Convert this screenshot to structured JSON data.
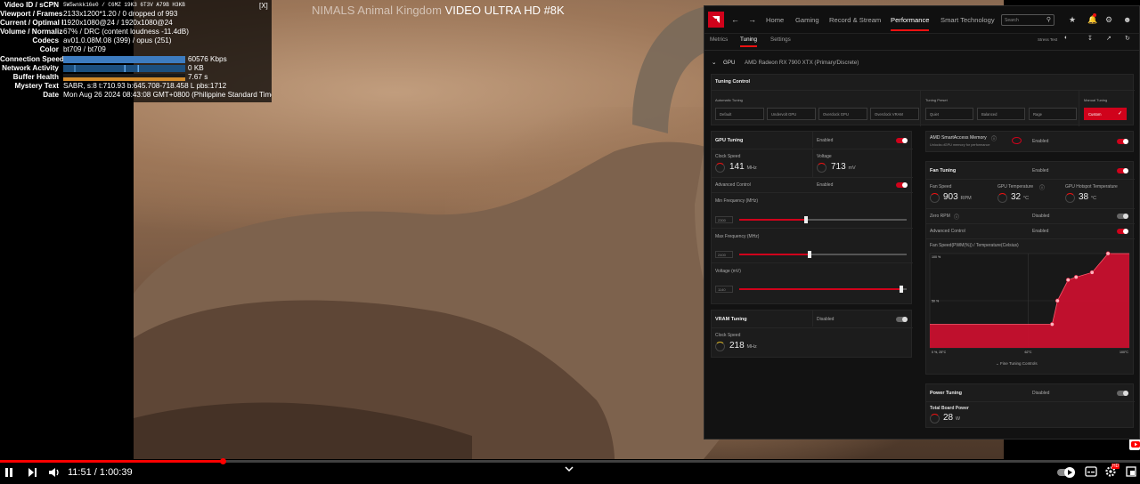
{
  "video": {
    "title_dim": "NIMALS Animal Kingdom",
    "title_bright": "VIDEO ULTRA HD #8K"
  },
  "stats": {
    "close_label": "[X]",
    "rows": [
      {
        "label": "Video ID / sCPN",
        "value": "5W5wnkk16e0 / C6MZ 19K3 6T3V A79B H3KB"
      },
      {
        "label": "Viewport / Frames",
        "value": "2133x1200*1.20 / 0 dropped of 993"
      },
      {
        "label": "Current / Optimal Res",
        "value": "1920x1080@24 / 1920x1080@24"
      },
      {
        "label": "Volume / Normalized",
        "value": "67% / DRC (content loudness -11.4dB)"
      },
      {
        "label": "Codecs",
        "value": "av01.0.08M.08 (399) / opus (251)"
      },
      {
        "label": "Color",
        "value": "bt709 / bt709"
      },
      {
        "label": "Connection Speed",
        "value": "60576 Kbps"
      },
      {
        "label": "Network Activity",
        "value": "0 KB"
      },
      {
        "label": "Buffer Health",
        "value": "7.67 s"
      },
      {
        "label": "Mystery Text",
        "value": "SABR, s:8 t:710.93 b:645.708-718.458 L pbs:1712"
      },
      {
        "label": "Date",
        "value": "Mon Aug 26 2024 08:43:08 GMT+0800 (Philippine Standard Time)"
      }
    ]
  },
  "player": {
    "time_current": "11:51",
    "time_separator": " / ",
    "time_total": "1:00:39",
    "progress_fraction": 0.195,
    "pause_icon": "pause-icon",
    "next_icon": "next-icon",
    "volume_icon": "volume-icon",
    "autoplay_icon": "autoplay-toggle-icon",
    "settings_icon": "gear-icon",
    "hd_badge": "HD",
    "expand_icon": "chevron-down-icon"
  },
  "amd": {
    "logo": "AMD",
    "nav": [
      "Home",
      "Gaming",
      "Record & Stream",
      "Performance",
      "Smart Technology"
    ],
    "nav_active": "Performance",
    "search_placeholder": "Search",
    "subtabs": [
      "Metrics",
      "Tuning",
      "Settings"
    ],
    "subtab_active": "Tuning",
    "stress_test": "Stress Test",
    "gpu_label": "GPU",
    "gpu_name": "AMD Radeon RX 7900 XTX (Primary/Discrete)",
    "tuning_control": {
      "title": "Tuning Control",
      "automatic_label": "Automatic Tuning",
      "automatic_options": [
        "Default",
        "Undervolt GPU",
        "Overclock GPU",
        "Overclock VRAM"
      ],
      "preset_label": "Tuning Preset",
      "preset_options": [
        "Quiet",
        "Balanced",
        "Rage"
      ],
      "manual_label": "Manual Tuning",
      "manual_option": "Custom"
    },
    "gpu_tuning": {
      "title": "GPU Tuning",
      "state": "Enabled",
      "clock_label": "Clock Speed",
      "clock_value": "141",
      "clock_unit": "MHz",
      "voltage_label": "Voltage",
      "voltage_value": "713",
      "voltage_unit": "mV",
      "advanced_label": "Advanced Control",
      "advanced_state": "Enabled",
      "min_freq_label": "Min Frequency (MHz)",
      "min_freq_value": "2300",
      "min_freq_fraction": 0.4,
      "max_freq_label": "Max Frequency (MHz)",
      "max_freq_value": "2400",
      "max_freq_fraction": 0.42,
      "voltage_slider_label": "Voltage (mV)",
      "voltage_slider_value": "1140",
      "voltage_slider_fraction": 0.97
    },
    "vram_tuning": {
      "title": "VRAM Tuning",
      "state": "Disabled",
      "clock_label": "Clock Speed",
      "clock_value": "218",
      "clock_unit": "MHz"
    },
    "sam": {
      "title": "AMD SmartAccess Memory",
      "desc": "Unlocks dGPU memory for performance",
      "state": "Enabled"
    },
    "fan_tuning": {
      "title": "Fan Tuning",
      "state": "Enabled",
      "speed_label": "Fan Speed",
      "speed_value": "903",
      "speed_unit": "RPM",
      "temp_label": "GPU Temperature",
      "temp_value": "32",
      "temp_unit": "°C",
      "hotspot_label": "GPU Hotspot Temperature",
      "hotspot_value": "38",
      "hotspot_unit": "°C",
      "zero_rpm_label": "Zero RPM",
      "zero_rpm_state": "Disabled",
      "advanced_label": "Advanced Control",
      "advanced_state": "Enabled",
      "chart_label": "Fan Speed(PWM(%)) / Temperature(Celsius)",
      "y_top": "100 %",
      "y_mid": "50 %",
      "x_left": "0 %, 25°C",
      "x_mid": "62°C",
      "x_right": "100°C",
      "fine_tuning": "Fine Tuning Controls"
    },
    "power_tuning": {
      "title": "Power Tuning",
      "state": "Disabled",
      "board_label": "Total Board Power",
      "board_value": "28",
      "board_unit": "W"
    }
  },
  "chart_data": {
    "type": "area",
    "title": "Fan Speed(PWM(%)) / Temperature(Celsius)",
    "xlabel": "",
    "ylabel": "",
    "x_tick_labels": [
      "0 %, 25°C",
      "62°C",
      "100°C"
    ],
    "y_tick_labels": [
      "100 %",
      "50 %"
    ],
    "xlim": [
      25,
      100
    ],
    "ylim": [
      0,
      100
    ],
    "series": [
      {
        "x": [
          25,
          71,
          73,
          77,
          80,
          86,
          92,
          100
        ],
        "values": [
          25,
          25,
          50,
          72,
          75,
          80,
          100,
          100
        ]
      }
    ],
    "color": "#c8102e"
  }
}
